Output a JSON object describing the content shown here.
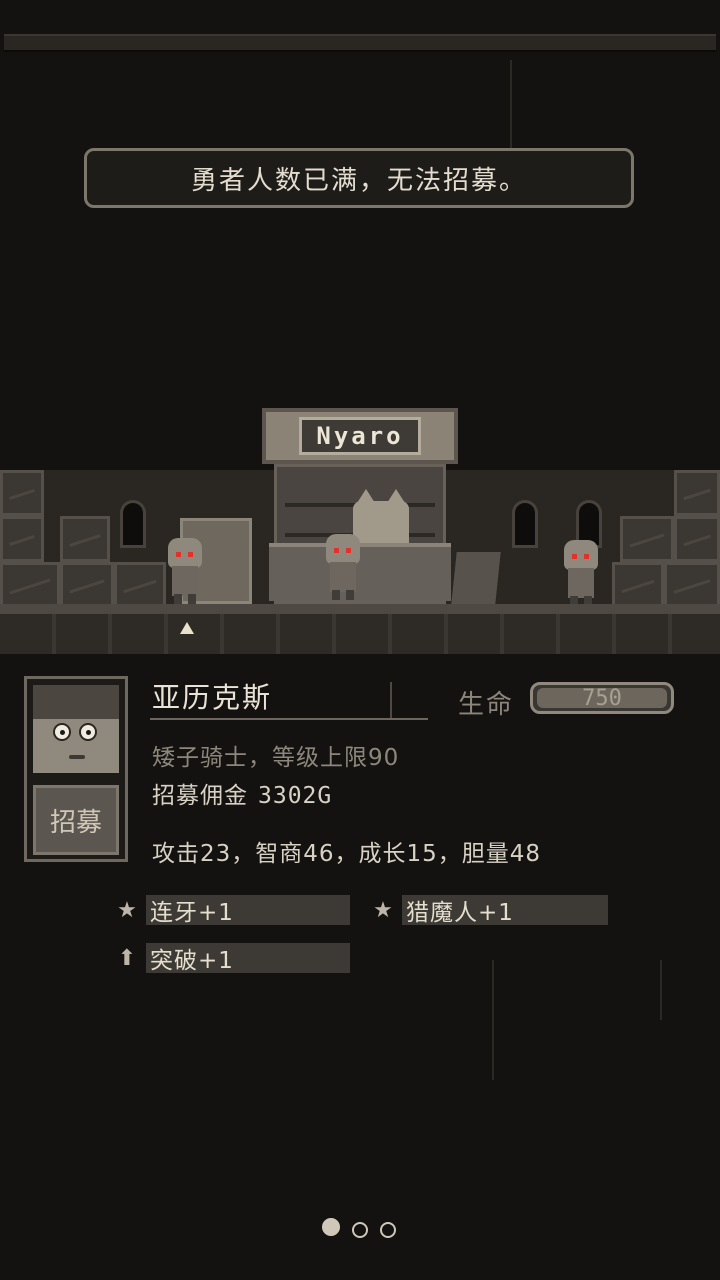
{
  "notice": {
    "text": "勇者人数已满，无法招募。"
  },
  "shop": {
    "sign": "Nyaro"
  },
  "hero": {
    "name": "亚历克斯",
    "hp_label": "生命",
    "hp_value": "750",
    "class_line": "矮子骑士，等级上限90",
    "fee_label": "招募佣金",
    "fee_value": "3302G",
    "stats": "攻击23，智商46，成长15，胆量48",
    "recruit_label": "招募"
  },
  "traits": [
    {
      "icon": "star-icon",
      "label": "连牙+1"
    },
    {
      "icon": "star-icon",
      "label": "猎魔人+1"
    },
    {
      "icon": "arrow-up-icon",
      "label": "突破+1"
    }
  ],
  "pager": {
    "total": 3,
    "active": 1
  },
  "colors": {
    "background": "#141210",
    "accent_red": "#e2302a",
    "text": "#d8d2c4"
  }
}
